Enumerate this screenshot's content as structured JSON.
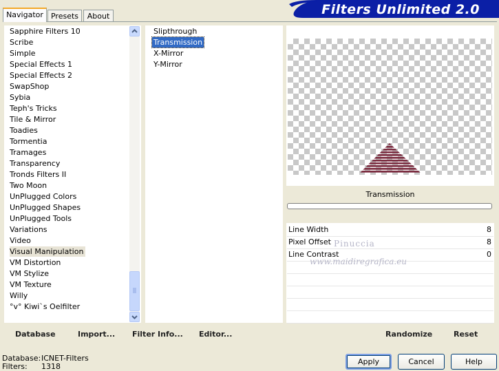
{
  "tabs": [
    {
      "label": "Navigator",
      "active": true
    },
    {
      "label": "Presets",
      "active": false
    },
    {
      "label": "About",
      "active": false
    }
  ],
  "app_title": "Filters Unlimited 2.0",
  "categories": [
    "Sapphire Filters 10",
    "Scribe",
    "Simple",
    "Special Effects 1",
    "Special Effects 2",
    "SwapShop",
    "Sybia",
    "Teph's Tricks",
    "Tile & Mirror",
    "Toadies",
    "Tormentia",
    "Tramages",
    "Transparency",
    "Tronds Filters II",
    "Two Moon",
    "UnPlugged Colors",
    "UnPlugged Shapes",
    "UnPlugged Tools",
    "Variations",
    "Video",
    "Visual Manipulation",
    "VM Distortion",
    "VM Stylize",
    "VM Texture",
    "Willy",
    "°v° Kiwi`s Oelfilter"
  ],
  "selected_category": "Visual Manipulation",
  "filters": [
    "Slipthrough",
    "Transmission",
    "X-Mirror",
    "Y-Mirror"
  ],
  "selected_filter": "Transmission",
  "filter_name": "Transmission",
  "params": [
    {
      "label": "Line Width",
      "value": "8"
    },
    {
      "label": "Pixel Offset",
      "value": "8"
    },
    {
      "label": "Line Contrast",
      "value": "0"
    }
  ],
  "watermark": {
    "line1": "Pinuccia",
    "line2": "www.maidiregrafica.eu"
  },
  "toolbar": {
    "database": "Database",
    "import": "Import...",
    "filter_info": "Filter Info...",
    "editor": "Editor...",
    "randomize": "Randomize",
    "reset": "Reset"
  },
  "status": {
    "database_label": "Database:",
    "database_value": "ICNET-Filters",
    "filters_label": "Filters:",
    "filters_value": "1318"
  },
  "buttons": {
    "apply": "Apply",
    "cancel": "Cancel",
    "help": "Help"
  },
  "colors": {
    "banner": "#0b1fa6",
    "selection": "#316ac5",
    "triangle": "#7a2a3e"
  }
}
